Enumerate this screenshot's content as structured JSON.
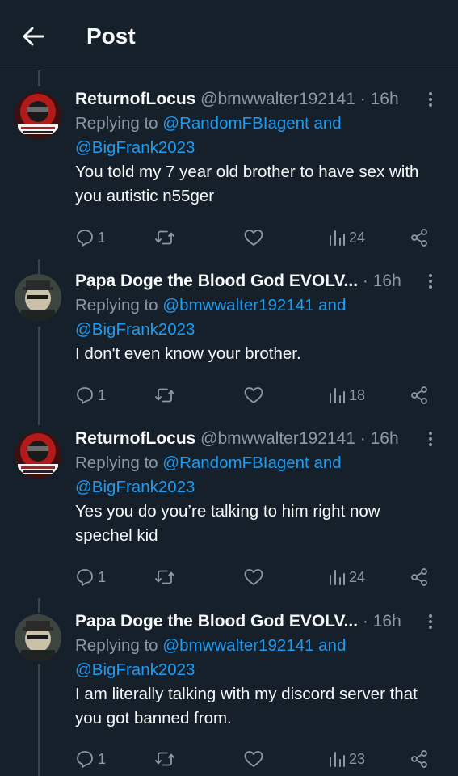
{
  "header": {
    "title": "Post"
  },
  "posts": [
    {
      "author": "ReturnofLocus",
      "handle": "@bmwwalter192141",
      "dot": "·",
      "time": "16h",
      "reply_prefix": "Replying to ",
      "reply_mention1": "@RandomFBIagent",
      "reply_and": " and",
      "reply_mention2": "@BigFrank2023",
      "text": "You told my 7 year old brother to have sex with you autistic n55ger",
      "replies": "1",
      "views": "24"
    },
    {
      "author": "Papa Doge the Blood God EVOLV...",
      "handle": "",
      "dot": "·",
      "time": "16h",
      "reply_prefix": "Replying to ",
      "reply_mention1": "@bmwwalter192141",
      "reply_and": " and",
      "reply_mention2": "@BigFrank2023",
      "text": "I don't even know your brother.",
      "replies": "1",
      "views": "18"
    },
    {
      "author": "ReturnofLocus",
      "handle": "@bmwwalter192141",
      "dot": "·",
      "time": "16h",
      "reply_prefix": "Replying to ",
      "reply_mention1": "@RandomFBIagent",
      "reply_and": " and",
      "reply_mention2": "@BigFrank2023",
      "text": "Yes you do you’re talking to him right now spechel kid",
      "replies": "1",
      "views": "24"
    },
    {
      "author": "Papa Doge the Blood God EVOLV...",
      "handle": "",
      "dot": "·",
      "time": "16h",
      "reply_prefix": "Replying to ",
      "reply_mention1": "@bmwwalter192141",
      "reply_and": " and",
      "reply_mention2": "@BigFrank2023",
      "text": "I am literally talking with my discord server that you got banned from.",
      "replies": "1",
      "views": "23"
    }
  ],
  "icons": {
    "back": "back-arrow-icon",
    "more": "more-vertical-icon",
    "reply": "reply-icon",
    "retweet": "retweet-icon",
    "like": "heart-icon",
    "views": "views-chart-icon",
    "share": "share-icon"
  },
  "colors": {
    "background": "#15202b",
    "text": "#f7f9f9",
    "secondary": "#8b98a5",
    "link": "#1d9bf0",
    "divider": "#38444d"
  }
}
